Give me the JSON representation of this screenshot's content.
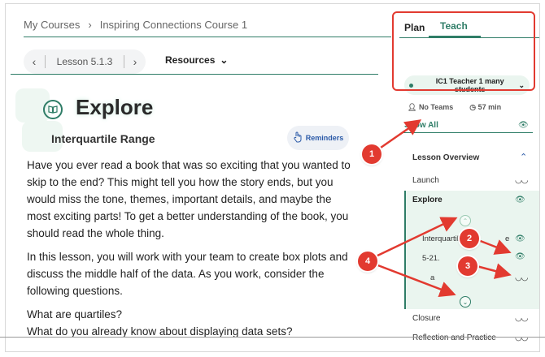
{
  "breadcrumb": {
    "items": [
      "My Courses",
      "Inspiring Connections Course 1"
    ],
    "separator": "›"
  },
  "lesson_nav": {
    "prev": "‹",
    "label": "Lesson 5.1.3",
    "next": "›"
  },
  "resources": {
    "label": "Resources",
    "chevron": "⌄"
  },
  "page": {
    "title": "Explore",
    "subtitle": "Interquartile Range",
    "reminders_label": "Reminders",
    "paragraphs": [
      "Have you ever read a book that was so exciting that you wanted to skip to the end? This might tell you how the story ends, but you would miss the tone, themes, important details, and maybe the most exciting parts! To get a better understanding of the book, you should read the whole thing.",
      "In this lesson, you will work with your team to create box plots and discuss the middle half of the data. As you work, consider the following questions."
    ],
    "questions": [
      "What are quartiles?",
      "What do you already know about displaying data sets?"
    ]
  },
  "side": {
    "tabs": [
      "Plan",
      "Teach"
    ],
    "active_tab": "Teach",
    "teacher": "IC1 Teacher 1 many students",
    "teams": "No Teams",
    "duration": "57 min",
    "show_all": "Show All",
    "overview": "Lesson Overview",
    "items": {
      "launch": "Launch",
      "explore": "Explore",
      "closure": "Closure",
      "reflection": "Reflection and Practice"
    },
    "subitems": [
      "Interquartile Range",
      "5-21.",
      "a"
    ],
    "subitems_visible": [
      "Interquartile",
      "e",
      "5-21.",
      "a"
    ]
  },
  "annotations": [
    "1",
    "2",
    "3",
    "4"
  ],
  "colors": {
    "accent": "#2f7d67",
    "callout": "#e23a30",
    "link": "#2b5aa8"
  }
}
